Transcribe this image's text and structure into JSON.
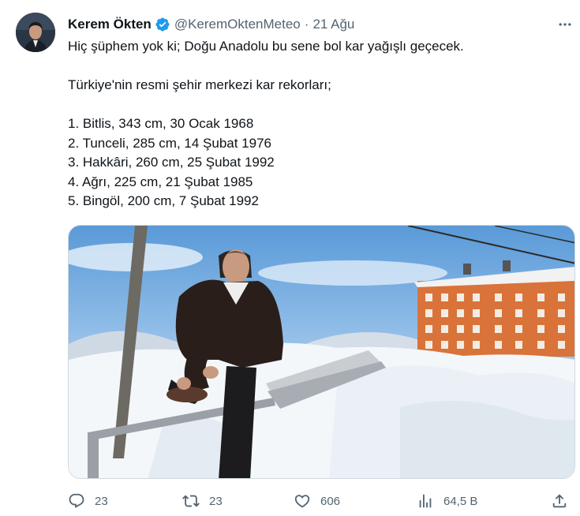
{
  "author": {
    "display_name": "Kerem Ökten",
    "handle": "@KeremOktenMeteo",
    "separator": "·",
    "date": "21 Ağu",
    "verified_icon": "verified-badge-icon"
  },
  "tweet": {
    "lines": [
      "Hiç şüphem yok ki; Doğu Anadolu bu sene bol kar yağışlı geçecek.",
      "Türkiye'nin resmi şehir merkezi kar rekorları;",
      "1. Bitlis, 343 cm, 30 Ocak 1968",
      "2. Tunceli, 285 cm, 14 Şubat 1976",
      "3. Hakkâri, 260 cm, 25 Şubat 1992",
      "4. Ağrı, 225 cm, 21 Şubat 1985",
      "5. Bingöl, 200 cm, 7 Şubat 1992"
    ]
  },
  "actions": {
    "reply": {
      "icon": "reply-icon",
      "count": "23"
    },
    "retweet": {
      "icon": "retweet-icon",
      "count": "23"
    },
    "like": {
      "icon": "heart-icon",
      "count": "606"
    },
    "views": {
      "icon": "views-icon",
      "count": "64,5 B"
    },
    "share": {
      "icon": "share-icon"
    }
  },
  "colors": {
    "text": "#0f1419",
    "secondary": "#536471",
    "verified": "#1d9bf0",
    "building": "#d9733a"
  }
}
